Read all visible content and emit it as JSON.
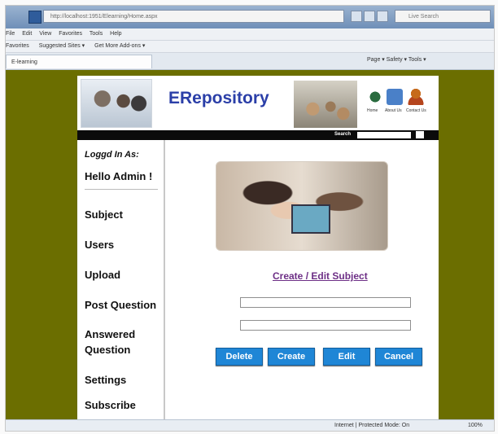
{
  "browser": {
    "address": "http://localhost:1951/Elearning/Home.aspx",
    "search_placeholder": "Live Search",
    "menu": [
      "File",
      "Edit",
      "View",
      "Favorites",
      "Tools",
      "Help"
    ],
    "favorites": [
      "Favorites",
      "Suggested Sites ▾",
      "Get More Add-ons ▾"
    ],
    "tab_title": "E-learning",
    "tools": "Page ▾  Safety ▾  Tools ▾",
    "status_zone": "Internet | Protected Mode: On",
    "zoom": "100%"
  },
  "header": {
    "brand": "ERepository",
    "icons": [
      {
        "label": "Home",
        "icon": "home-icon"
      },
      {
        "label": "About Us",
        "icon": "about-icon"
      },
      {
        "label": "Contact Us",
        "icon": "contact-icon"
      }
    ],
    "search_label": "Search"
  },
  "sidebar": {
    "logged_label": "Loggd In As:",
    "greeting": "Hello Admin !",
    "items": [
      "Subject",
      "Users",
      "Upload",
      "Post Question",
      "Answered Question",
      "Settings",
      "Subscribe"
    ]
  },
  "main": {
    "title": "Create / Edit Subject",
    "field1_value": "",
    "field2_value": "",
    "buttons": [
      "Delete",
      "Create",
      "Edit",
      "Cancel"
    ]
  },
  "colors": {
    "background": "#6b6e00",
    "brand": "#2b3fa8",
    "title_link": "#6d2f86",
    "button": "#1f86d6"
  }
}
